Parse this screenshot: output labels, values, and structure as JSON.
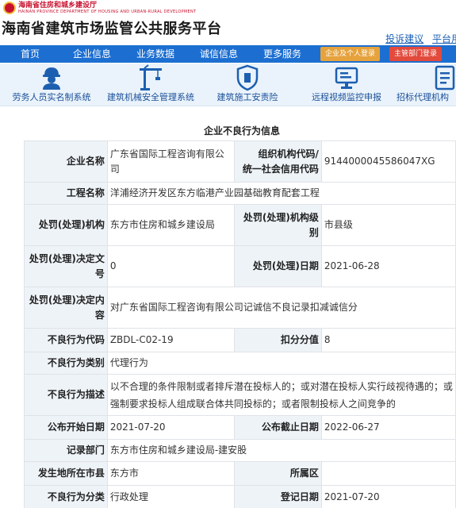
{
  "header": {
    "org_name": "海南省住房和城乡建设厅",
    "org_name_en": "HAINAN PROVINCE DEPARTMENT OF HOUSING AND URBAN-RURAL DEVELOPMENT",
    "site_title": "海南省建筑市场监管公共服务平台",
    "links": [
      "投诉建议",
      "平台用"
    ]
  },
  "nav": {
    "items": [
      "首页",
      "企业信息",
      "业务数据",
      "诚信信息",
      "更多服务"
    ],
    "login_enterprise": "企业及个人登录",
    "login_department": "主管部门登录"
  },
  "services": [
    {
      "label": "劳务人员实名制系统",
      "icon": "worker-icon"
    },
    {
      "label": "建筑机械安全管理系统",
      "icon": "crane-icon"
    },
    {
      "label": "建筑施工安责险",
      "icon": "insurance-icon"
    },
    {
      "label": "远程视频监控申报",
      "icon": "monitor-icon"
    },
    {
      "label": "招标代理机构",
      "icon": "document-icon"
    }
  ],
  "detail": {
    "title": "企业不良行为信息",
    "company_name_label": "企业名称",
    "company_name": "广东省国际工程咨询有限公司",
    "org_code_label_1": "组织机构代码/",
    "org_code_label_2": "统一社会信用代码",
    "org_code": "9144000045586047XG",
    "project_label": "工程名称",
    "project": "洋浦经济开发区东方临港产业园基础教育配套工程",
    "penalty_org_label": "处罚(处理)机构",
    "penalty_org": "东方市住房和城乡建设局",
    "penalty_level_label": "处罚(处理)机构级别",
    "penalty_level": "市县级",
    "decision_no_label": "处罚(处理)决定文号",
    "decision_no": "0",
    "penalty_date_label": "处罚(处理)日期",
    "penalty_date": "2021-06-28",
    "decision_content_label": "处罚(处理)决定内容",
    "decision_content": "对广东省国际工程咨询有限公司记诚信不良记录扣减诚信分",
    "behavior_code_label": "不良行为代码",
    "behavior_code": "ZBDL-C02-19",
    "deduct_label": "扣分分值",
    "deduct": "8",
    "category_label": "不良行为类别",
    "category": "代理行为",
    "description_label": "不良行为描述",
    "description": "以不合理的条件限制或者排斥潜在投标人的；或对潜在投标人实行歧视待遇的；或强制要求投标人组成联合体共同投标的；或者限制投标人之间竞争的",
    "publish_start_label": "公布开始日期",
    "publish_start": "2021-07-20",
    "publish_end_label": "公布截止日期",
    "publish_end": "2022-06-27",
    "record_dept_label": "记录部门",
    "record_dept": "东方市住房和城乡建设局-建安股",
    "city_label": "发生地所在市县",
    "city": "东方市",
    "district_label": "所属区",
    "district": "",
    "class_label": "不良行为分类",
    "class": "行政处理",
    "reg_date_label": "登记日期",
    "reg_date": "2021-07-20"
  }
}
